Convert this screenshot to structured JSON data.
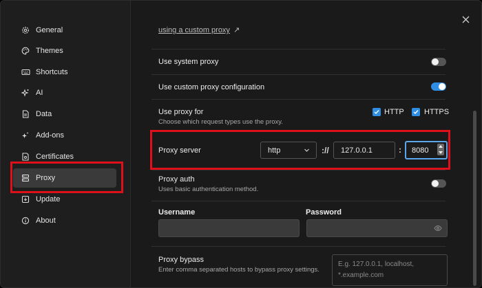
{
  "sidebar": {
    "items": [
      {
        "label": "General",
        "icon": "gear-icon"
      },
      {
        "label": "Themes",
        "icon": "palette-icon"
      },
      {
        "label": "Shortcuts",
        "icon": "keyboard-icon"
      },
      {
        "label": "AI",
        "icon": "sparkle-icon"
      },
      {
        "label": "Data",
        "icon": "document-icon"
      },
      {
        "label": "Add-ons",
        "icon": "sparkles-icon"
      },
      {
        "label": "Certificates",
        "icon": "certificate-icon"
      },
      {
        "label": "Proxy",
        "icon": "proxy-icon"
      },
      {
        "label": "Update",
        "icon": "download-icon"
      },
      {
        "label": "About",
        "icon": "info-icon"
      }
    ],
    "active": "Proxy"
  },
  "main": {
    "custom_proxy_link": "using a custom proxy",
    "link_arrow": "↗",
    "system_proxy": {
      "label": "Use system proxy",
      "enabled": false
    },
    "custom_proxy": {
      "label": "Use custom proxy configuration",
      "enabled": true
    },
    "use_proxy_for": {
      "label": "Use proxy for",
      "description": "Choose which request types use the proxy.",
      "http_label": "HTTP",
      "https_label": "HTTPS",
      "http_checked": true,
      "https_checked": true
    },
    "proxy_server": {
      "label": "Proxy server",
      "protocol": "http",
      "scheme_sep": "://",
      "host": "127.0.0.1",
      "port_sep": ":",
      "port": "8080"
    },
    "proxy_auth": {
      "label": "Proxy auth",
      "description": "Uses basic authentication method.",
      "enabled": false
    },
    "username": {
      "label": "Username",
      "value": ""
    },
    "password": {
      "label": "Password",
      "value": ""
    },
    "proxy_bypass": {
      "label": "Proxy bypass",
      "description": "Enter comma separated hosts to bypass proxy settings.",
      "placeholder_line1": "E.g. 127.0.0.1, localhost,",
      "placeholder_line2": "*.example.com"
    }
  },
  "colors": {
    "accent": "#2f8de4",
    "highlight": "#e0101a"
  }
}
